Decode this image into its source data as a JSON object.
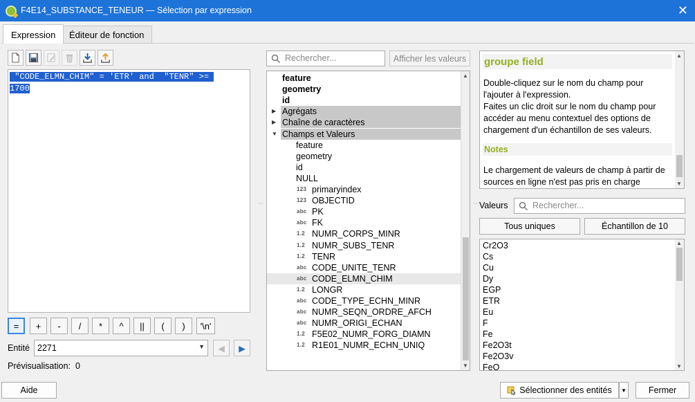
{
  "window": {
    "title": "F4E14_SUBSTANCE_TENEUR — Sélection par expression",
    "close_glyph": "✕"
  },
  "tabs": [
    {
      "label": "Expression",
      "active": true
    },
    {
      "label": "Éditeur de fonction",
      "active": false
    }
  ],
  "toolbar": {
    "buttons": [
      {
        "icon": "new-file-icon",
        "enabled": true
      },
      {
        "icon": "save-icon",
        "enabled": true
      },
      {
        "icon": "edit-icon",
        "enabled": false
      },
      {
        "icon": "trash-icon",
        "enabled": false
      },
      {
        "icon": "import-icon",
        "enabled": true
      },
      {
        "icon": "export-icon",
        "enabled": true
      }
    ]
  },
  "expression": {
    "lines": [
      " \"CODE_ELMN_CHIM\" = 'ETR' and  \"TENR\" >= ",
      "1700"
    ]
  },
  "operators": [
    "=",
    "+",
    "-",
    "/",
    "*",
    "^",
    "||",
    "(",
    ")",
    "'\\n'"
  ],
  "entity": {
    "label": "Entité",
    "value": "2271",
    "prev_icon": "◀",
    "next_icon": "▶"
  },
  "preview": {
    "text": "Prévisualisation:  0"
  },
  "search": {
    "placeholder": "Rechercher...",
    "show_values_label": "Afficher les valeurs"
  },
  "tree": {
    "items": [
      {
        "label": "feature",
        "style": "bold",
        "indent": 0
      },
      {
        "label": "geometry",
        "style": "bold",
        "indent": 0
      },
      {
        "label": "id",
        "style": "bold",
        "indent": 0
      },
      {
        "label": "Agrégats",
        "style": "group",
        "caret": "▶"
      },
      {
        "label": "Chaîne de caractères",
        "style": "group",
        "caret": "▶"
      },
      {
        "label": "Champs et Valeurs",
        "style": "group",
        "caret": "▼"
      },
      {
        "label": "feature",
        "style": "child"
      },
      {
        "label": "geometry",
        "style": "child"
      },
      {
        "label": "id",
        "style": "child"
      },
      {
        "label": "NULL",
        "style": "child"
      },
      {
        "label": "primaryindex",
        "style": "field",
        "badge": "123"
      },
      {
        "label": "OBJECTID",
        "style": "field",
        "badge": "123"
      },
      {
        "label": "PK",
        "style": "field",
        "badge": "abc"
      },
      {
        "label": "FK",
        "style": "field",
        "badge": "abc"
      },
      {
        "label": "NUMR_CORPS_MINR",
        "style": "field",
        "badge": "1.2"
      },
      {
        "label": "NUMR_SUBS_TENR",
        "style": "field",
        "badge": "1.2"
      },
      {
        "label": "TENR",
        "style": "field",
        "badge": "1.2"
      },
      {
        "label": "CODE_UNITE_TENR",
        "style": "field",
        "badge": "abc"
      },
      {
        "label": "CODE_ELMN_CHIM",
        "style": "field",
        "badge": "abc",
        "highlight": true
      },
      {
        "label": "LONGR",
        "style": "field",
        "badge": "1.2"
      },
      {
        "label": "CODE_TYPE_ECHN_MINR",
        "style": "field",
        "badge": "abc"
      },
      {
        "label": "NUMR_SEQN_ORDRE_AFCH",
        "style": "field",
        "badge": "abc"
      },
      {
        "label": "NUMR_ORIGI_ECHAN",
        "style": "field",
        "badge": "abc"
      },
      {
        "label": "F5E02_NUMR_FORG_DIAMN",
        "style": "field",
        "badge": "1.2"
      },
      {
        "label": "R1E01_NUMR_ECHN_UNIQ",
        "style": "field",
        "badge": "1.2"
      }
    ]
  },
  "help": {
    "title": "groupe field",
    "body": "Double-cliquez sur le nom du champ pour l'ajouter à l'expression.\nFaites un clic droit sur le nom du champ pour accéder au menu contextuel des options de chargement d'un échantillon de ses valeurs.",
    "notes_title": "Notes",
    "notes_body": "Le chargement de valeurs de champ à partir de sources en ligne n'est pas pris en charge"
  },
  "values": {
    "label": "Valeurs",
    "search_placeholder": "Rechercher...",
    "all_unique_label": "Tous uniques",
    "sample_label": "Échantillon de 10",
    "items": [
      "Cr2O3",
      "Cs",
      "Cu",
      "Dy",
      "EGP",
      "ETR",
      "Eu",
      "F",
      "Fe",
      "Fe2O3t",
      "Fe2O3v",
      "FeO"
    ]
  },
  "buttons": {
    "help": "Aide",
    "select": "Sélectionner des entités",
    "select_arrow": "▼",
    "close": "Fermer"
  },
  "colors": {
    "titlebar": "#1e73d8",
    "selection": "#1f5fd0",
    "help_heading": "#93b023",
    "group_row": "#c8c8c8"
  }
}
